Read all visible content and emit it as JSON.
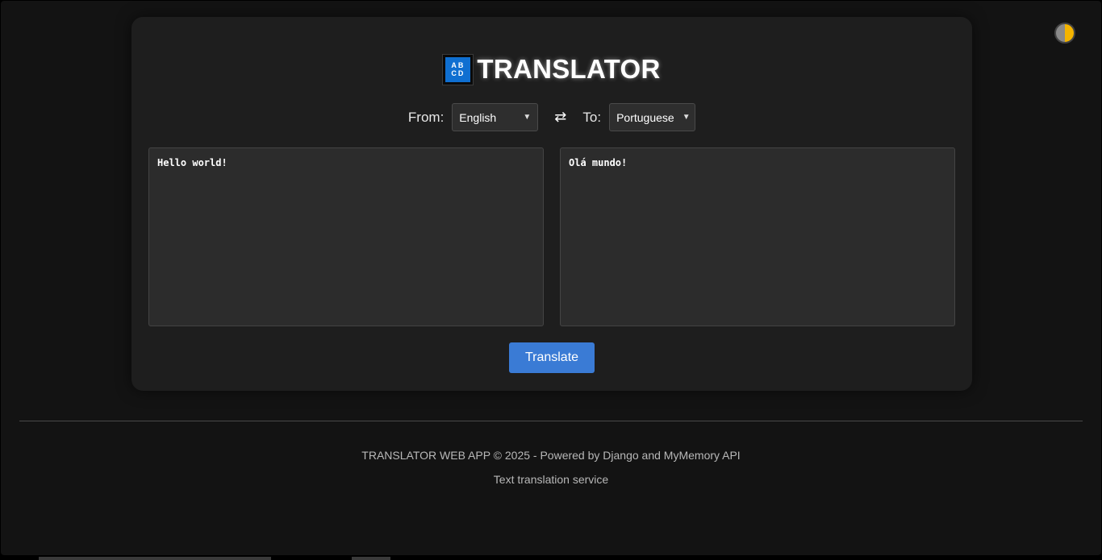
{
  "app": {
    "title": "TRANSLATOR",
    "logo_letters": [
      "AB",
      "CD"
    ]
  },
  "languages": {
    "from_label": "From:",
    "from_value": "English",
    "to_label": "To:",
    "to_value": "Portuguese",
    "swap_icon": "⇄"
  },
  "input": {
    "text": "Hello world!"
  },
  "output": {
    "text": "Olá mundo!"
  },
  "actions": {
    "translate_label": "Translate"
  },
  "footer": {
    "line1": "TRANSLATOR WEB APP © 2025 - Powered by Django and MyMemory API",
    "line2": "Text translation service"
  },
  "colors": {
    "accent": "#3a7bd5",
    "background": "#131313",
    "card": "#1e1e1e",
    "logo": "#0f6fd1"
  },
  "icons": {
    "theme_toggle": "half-moon-icon",
    "swap": "swap-arrows-icon",
    "logo": "abcd-logo-icon"
  }
}
